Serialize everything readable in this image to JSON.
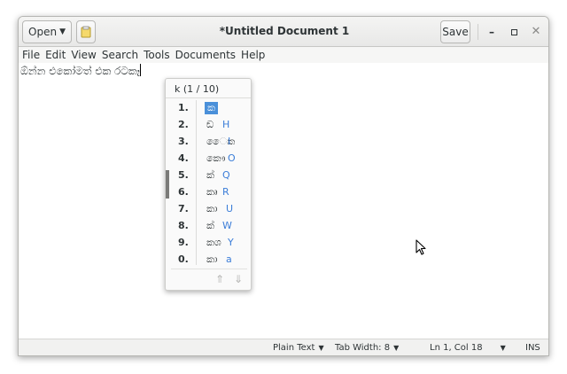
{
  "window": {
    "title": "*Untitled Document 1",
    "open_label": "Open",
    "save_label": "Save",
    "minimize_glyph": "–",
    "close_glyph": "✕"
  },
  "menubar": {
    "items": [
      "File",
      "Edit",
      "View",
      "Search",
      "Tools",
      "Documents",
      "Help"
    ]
  },
  "editor": {
    "committed_text": "ඕන්න එකෝමත් එක රටක",
    "preedit_text": "ෑ"
  },
  "candidates": {
    "header": "k (1 / 10)",
    "items": [
      {
        "num": "1.",
        "glyph": "ක",
        "key": ""
      },
      {
        "num": "2.",
        "glyph": "ඞ",
        "key": "H"
      },
      {
        "num": "3.",
        "glyph": "ෛක",
        "key": "I"
      },
      {
        "num": "4.",
        "glyph": "කෞ",
        "key": "O"
      },
      {
        "num": "5.",
        "glyph": "ක්",
        "key": "Q"
      },
      {
        "num": "6.",
        "glyph": "කෘ",
        "key": "R"
      },
      {
        "num": "7.",
        "glyph": "කා",
        "key": "U"
      },
      {
        "num": "8.",
        "glyph": "ක්",
        "key": "W"
      },
      {
        "num": "9.",
        "glyph": "කශ",
        "key": "Y"
      },
      {
        "num": "0.",
        "glyph": "කා",
        "key": "a"
      }
    ],
    "prev_glyph": "⇑",
    "next_glyph": "⇓"
  },
  "statusbar": {
    "language": "Plain Text",
    "tab_width": "Tab Width: 8",
    "position": "Ln 1, Col 18",
    "mode": "INS"
  },
  "icons": {
    "open_caret": "chevron-down-icon",
    "recent": "recent-documents-icon",
    "pointer": "mouse-pointer-icon"
  }
}
